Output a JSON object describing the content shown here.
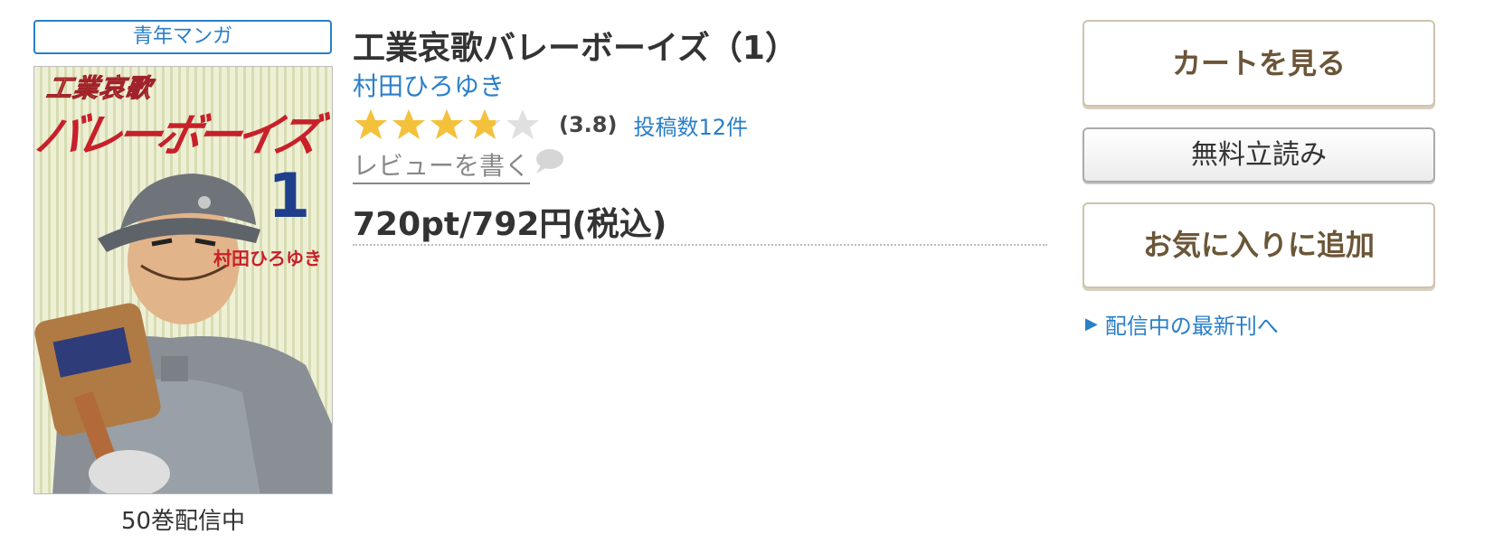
{
  "genre_badge": "青年マンガ",
  "cover": {
    "logo_line1": "工業哀歌",
    "logo_line2": "バレーボーイズ",
    "volume_number": "1",
    "author_on_cover": "村田ひろゆき"
  },
  "volumes_label": "50巻配信中",
  "title": "工業哀歌バレーボーイズ（1）",
  "author": "村田ひろゆき",
  "rating": {
    "score": 3.8,
    "score_text": "(3.8)",
    "max_stars": 5,
    "review_count_text": "投稿数12件"
  },
  "write_review": "レビューを書く",
  "price": "720pt/792円(税込)",
  "buttons": {
    "cart": "カートを見る",
    "trial": "無料立読み",
    "favorite": "お気に入りに追加"
  },
  "latest_link": "配信中の最新刊へ",
  "colors": {
    "link_blue": "#2a7fc9",
    "star_gold": "#f4c13a",
    "star_empty": "#e0e0e0",
    "button_text_brown": "#6b5638"
  },
  "icons": {
    "star": "star-icon",
    "speech": "speech-bubble-icon",
    "arrow": "triangle-right-icon"
  }
}
